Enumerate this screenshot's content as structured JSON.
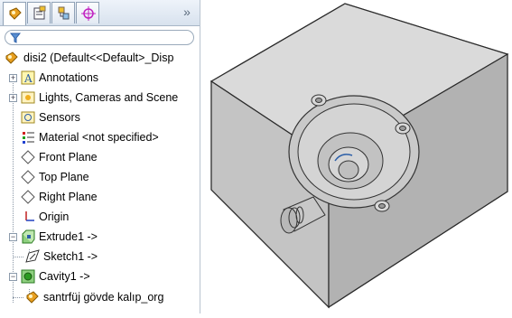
{
  "tabs": [
    {
      "icon": "feature-manager-icon"
    },
    {
      "icon": "property-manager-icon"
    },
    {
      "icon": "configuration-manager-icon"
    },
    {
      "icon": "dimxpert-manager-icon"
    }
  ],
  "overflow_label": "»",
  "tree": {
    "root": "disi2  (Default<<Default>_Disp",
    "items": [
      {
        "label": "Annotations"
      },
      {
        "label": "Lights, Cameras and Scene"
      },
      {
        "label": "Sensors"
      },
      {
        "label": "Material <not specified>"
      },
      {
        "label": "Front Plane"
      },
      {
        "label": "Top Plane"
      },
      {
        "label": "Right Plane"
      },
      {
        "label": "Origin"
      },
      {
        "label": "Extrude1 ->"
      },
      {
        "label": "Sketch1 ->"
      },
      {
        "label": "Cavity1 ->"
      },
      {
        "label": "santrfüj gövde kalıp_org"
      }
    ]
  },
  "colors": {
    "panel_bg": "#ffffff",
    "model_top": "#d9d9d9",
    "model_side": "#bcbcbc",
    "accent": "#2c5fa8"
  }
}
